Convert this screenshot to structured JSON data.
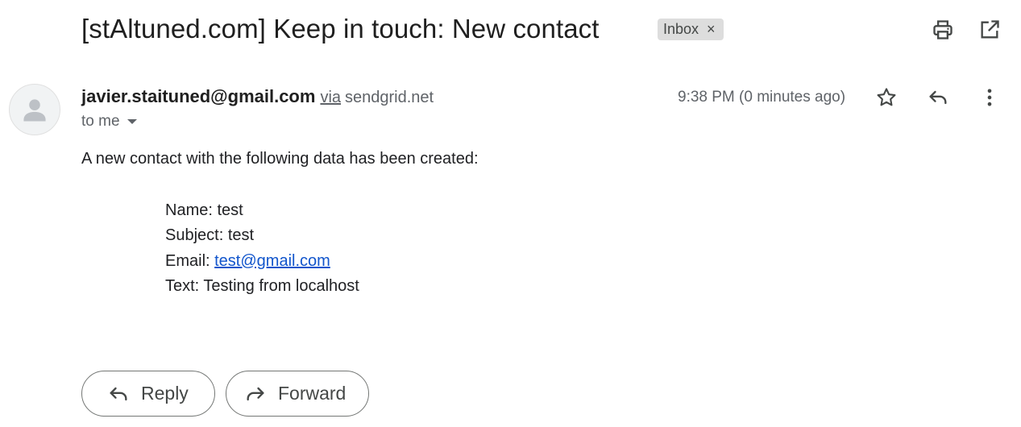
{
  "email": {
    "subject": "[stAltuned.com] Keep in touch: New contact",
    "label": "Inbox",
    "label_remove": "×",
    "sender_email": "javier.staituned@gmail.com",
    "via_label": "via",
    "via_domain": "sendgrid.net",
    "recipients": "to me",
    "timestamp": "9:38 PM (0 minutes ago)",
    "body": {
      "intro": "A new contact with the following data has been created:",
      "name_line": "Name: test",
      "subject_line": "Subject: test",
      "email_prefix": "Email: ",
      "email_link": "test@gmail.com",
      "text_line": "Text: Testing from localhost"
    }
  },
  "actions": {
    "reply_label": "Reply",
    "forward_label": "Forward"
  },
  "icons": {
    "print": "print-icon",
    "open_new_window": "open-in-new-icon",
    "star": "star-outline-icon",
    "reply": "reply-icon",
    "more": "more-vertical-icon",
    "forward": "forward-icon",
    "avatar": "default-avatar"
  },
  "colors": {
    "text_primary": "#1f1f1f",
    "text_secondary": "#5f6368",
    "link": "#1155cc",
    "chip_bg": "#dddddd",
    "pill_border": "#747775"
  }
}
